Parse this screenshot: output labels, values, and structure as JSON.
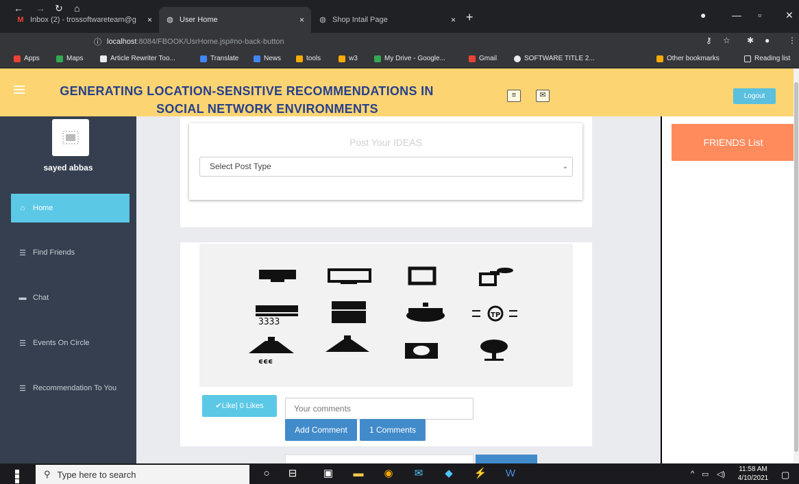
{
  "browser": {
    "tabs": [
      {
        "label": "Inbox (2) - trossoftwareteam@g",
        "close": "×"
      },
      {
        "label": "User Home",
        "close": "×"
      },
      {
        "label": "Shop Intail Page",
        "close": "×"
      }
    ],
    "new_tab": "+",
    "url_host": "localhost",
    "url_path": ":8084/FBOOK/UsrHome.jsp#no-back-button",
    "bookmarks": [
      "Apps",
      "Maps",
      "Article Rewriter Too...",
      "Translate",
      "News",
      "tools",
      "w3",
      "My Drive - Google...",
      "Gmail",
      "SOFTWARE TITLE 2...",
      "Other bookmarks",
      "Reading list"
    ]
  },
  "header": {
    "title_line1": "GENERATING LOCATION-SENSITIVE RECOMMENDATIONS IN",
    "title_line2": "SOCIAL NETWORK ENVIRONMENTS",
    "logout": "Logout"
  },
  "sidebar": {
    "username": "sayed abbas",
    "items": [
      {
        "label": "Home"
      },
      {
        "label": "Find Friends"
      },
      {
        "label": "Chat"
      },
      {
        "label": "Events On Circle"
      },
      {
        "label": "Recommendation To You"
      }
    ]
  },
  "post_form": {
    "title": "Post Your IDEAS",
    "select_value": "Select Post Type"
  },
  "post": {
    "like_label": "✔Like| 0 Likes",
    "comment_placeholder": "Your comments",
    "add_comment": "Add Comment",
    "comments_count": "1 Comments"
  },
  "right_panel": {
    "friends_list": "FRIENDS List"
  },
  "taskbar": {
    "search_placeholder": "Type here to search",
    "time": "11:58 AM",
    "date": "4/10/2021"
  },
  "colors": {
    "header_bg": "#fcd472",
    "title_color": "#27408b",
    "sidebar_bg": "#353f4f",
    "active_nav": "#5bc8e6",
    "friends_btn": "#ff8a5c",
    "primary_btn": "#428bca"
  }
}
